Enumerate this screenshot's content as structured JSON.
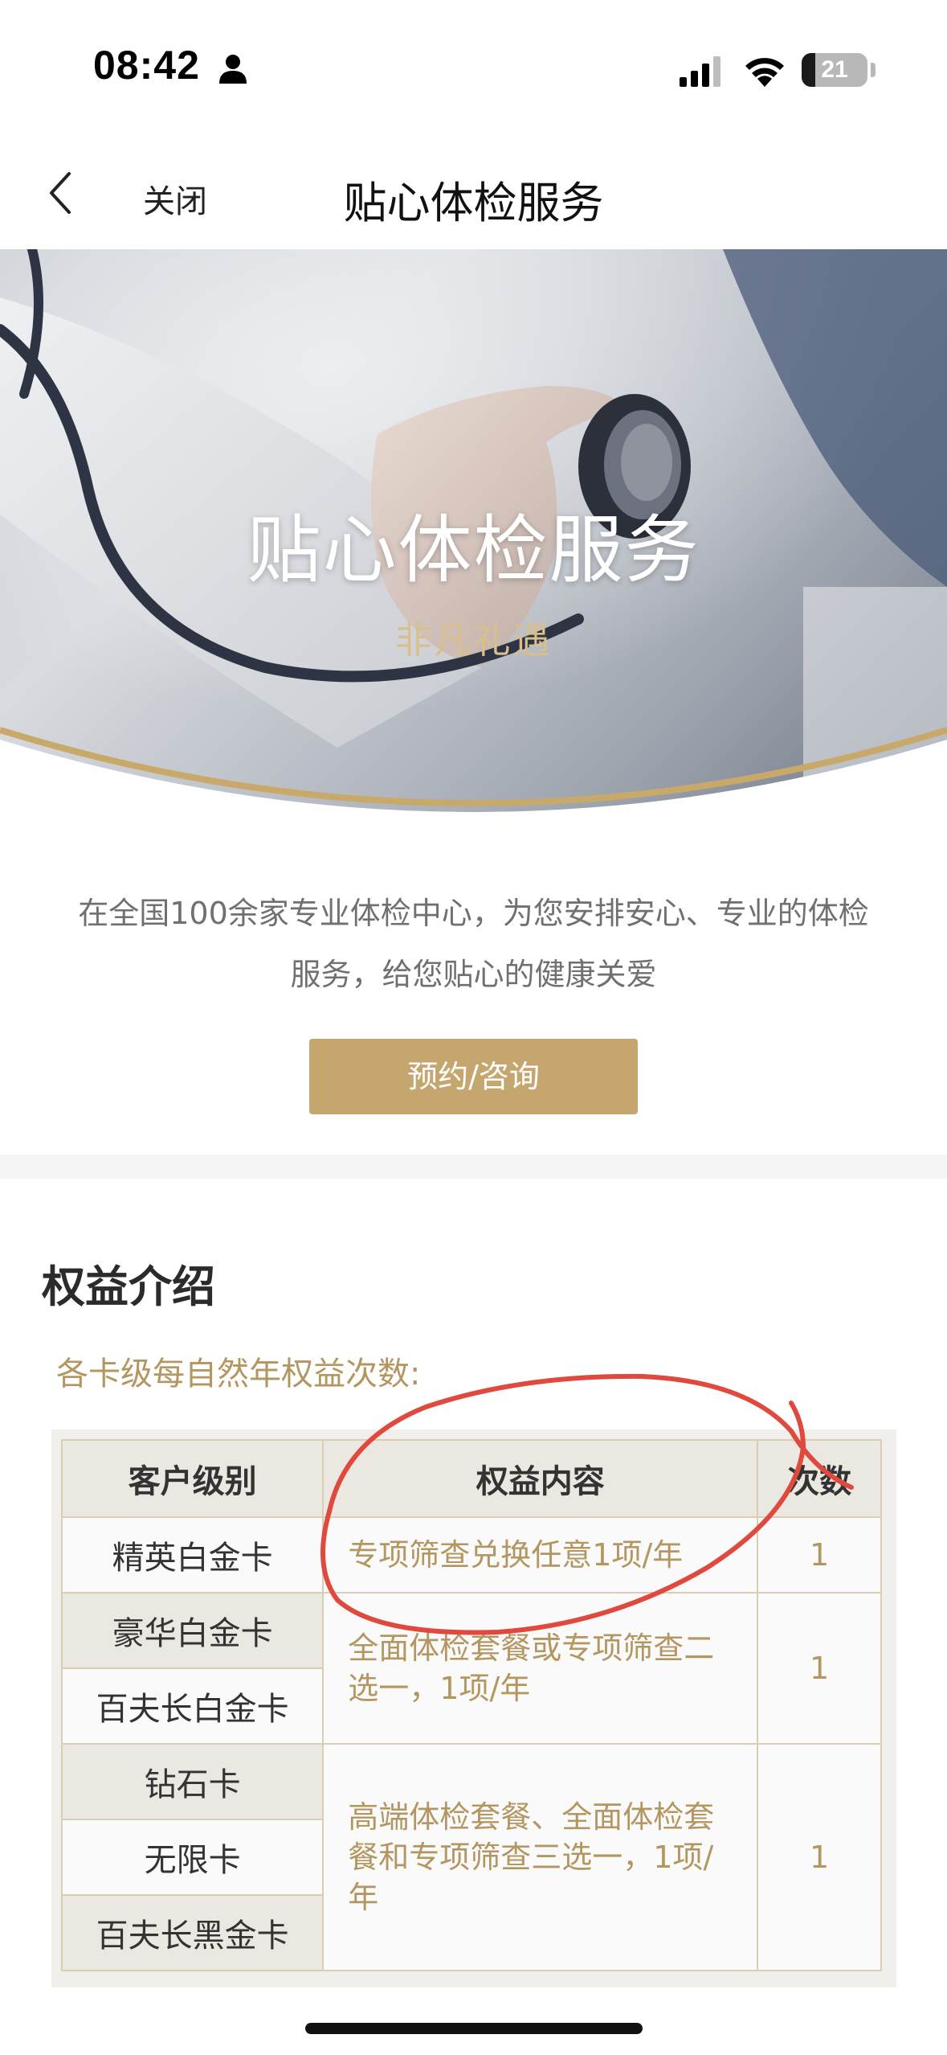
{
  "status_bar": {
    "time": "08:42",
    "battery": "21",
    "icons": [
      "person-icon",
      "signal-icon",
      "wifi-icon",
      "battery-icon"
    ]
  },
  "nav": {
    "back_icon": "chevron-left-icon",
    "close_label": "关闭",
    "title": "贴心体检服务"
  },
  "hero": {
    "title": "贴心体检服务",
    "subtitle": "非凡礼遇"
  },
  "intro": {
    "text": "在全国100余家专业体检中心，为您安排安心、专业的体检服务，给您贴心的健康关爱",
    "button_label": "预约/咨询"
  },
  "benefits": {
    "title": "权益介绍",
    "subtitle": "各卡级每自然年权益次数:",
    "headers": [
      "客户级别",
      "权益内容",
      "次数"
    ],
    "groups": [
      {
        "levels": [
          "精英白金卡"
        ],
        "content": "专项筛查兑换任意1项/年",
        "count": "1"
      },
      {
        "levels": [
          "豪华白金卡",
          "百夫长白金卡"
        ],
        "content": "全面体检套餐或专项筛查二选一，1项/年",
        "count": "1"
      },
      {
        "levels": [
          "钻石卡",
          "无限卡",
          "百夫长黑金卡"
        ],
        "content": "高端体检套餐、全面体检套餐和专项筛查三选一，1项/年",
        "count": "1"
      }
    ]
  },
  "colors": {
    "gold": "#c4a66e",
    "gold_text": "#b39660",
    "annotation_red": "#e0493d"
  }
}
